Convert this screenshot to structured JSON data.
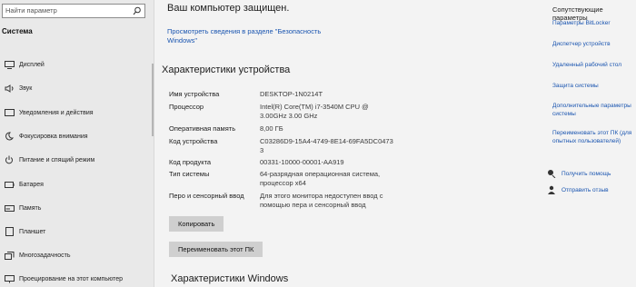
{
  "sidebar": {
    "search_placeholder": "Найти параметр",
    "section_title": "Система",
    "items": [
      {
        "label": "Дисплей",
        "icon": "display-icon"
      },
      {
        "label": "Звук",
        "icon": "sound-icon"
      },
      {
        "label": "Уведомления и действия",
        "icon": "notifications-icon"
      },
      {
        "label": "Фокусировка внимания",
        "icon": "focus-assist-icon"
      },
      {
        "label": "Питание и спящий режим",
        "icon": "power-icon"
      },
      {
        "label": "Батарея",
        "icon": "battery-icon"
      },
      {
        "label": "Память",
        "icon": "storage-icon"
      },
      {
        "label": "Планшет",
        "icon": "tablet-icon"
      },
      {
        "label": "Многозадачность",
        "icon": "multitasking-icon"
      },
      {
        "label": "Проецирование на этот компьютер",
        "icon": "projecting-icon"
      }
    ]
  },
  "main": {
    "protect_title": "Ваш компьютер защищен.",
    "protect_link": "Просмотреть сведения в разделе \"Безопасность Windows\"",
    "device_title": "Характеристики устройства",
    "specs": [
      {
        "key": "Имя устройства",
        "value": "DESKTOP-1N0214T"
      },
      {
        "key": "Процессор",
        "value": "Intel(R) Core(TM) i7-3540M CPU @ 3.00GHz   3.00 GHz"
      },
      {
        "key": "Оперативная память",
        "value": "8,00 ГБ"
      },
      {
        "key": "Код устройства",
        "value": "C03286D9-15A4-4749-8E14-69FA5DC0473 3"
      },
      {
        "key": "Код продукта",
        "value": "00331-10000-00001-AA919"
      },
      {
        "key": "Тип системы",
        "value": "64-разрядная операционная система, процессор x64"
      },
      {
        "key": "Перо и сенсорный ввод",
        "value": "Для этого монитора недоступен ввод с помощью пера и сенсорный ввод"
      }
    ],
    "copy_button": "Копировать",
    "rename_button": "Переименовать этот ПК",
    "windows_title": "Характеристики Windows"
  },
  "related": {
    "title": "Сопутствующие параметры",
    "links": [
      "Параметры BitLocker",
      "Диспетчер устройств",
      "Удаленный рабочий стол",
      "Защита системы",
      "Дополнительные параметры системы",
      "Переименовать этот ПК (для опытных пользователей)"
    ],
    "help": [
      {
        "label": "Получить помощь",
        "icon": "help-icon"
      },
      {
        "label": "Отправить отзыв",
        "icon": "feedback-icon"
      }
    ]
  }
}
